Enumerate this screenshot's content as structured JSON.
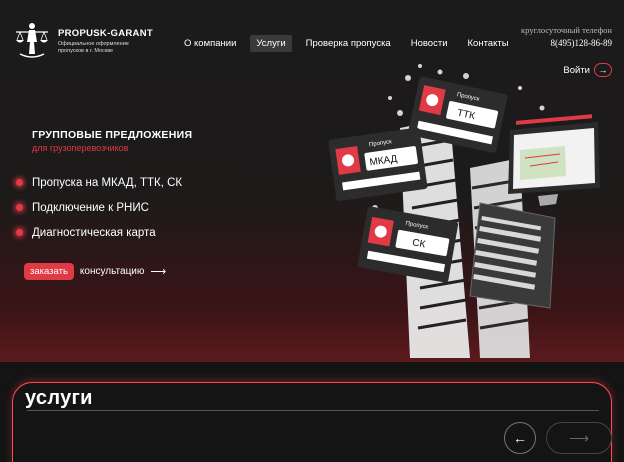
{
  "logo": {
    "title": "PROPUSK-GARANT",
    "subtitle": "Официальное оформление пропусков в г. Москве"
  },
  "nav": {
    "items": [
      {
        "label": "О компании",
        "active": false
      },
      {
        "label": "Услуги",
        "active": true
      },
      {
        "label": "Проверка пропуска",
        "active": false
      },
      {
        "label": "Новости",
        "active": false
      },
      {
        "label": "Контакты",
        "active": false
      }
    ]
  },
  "contact": {
    "phone_label": "круглосуточный телефон",
    "phone": "8(495)128-86-89"
  },
  "login": {
    "label": "Войти"
  },
  "hero": {
    "title": "ГРУППОВЫЕ ПРЕДЛОЖЕНИЯ",
    "subtitle": "для грузоперевозчиков",
    "features": [
      "Пропуска на МКАД, ТТК, СК",
      "Подключение к РНИС",
      "Диагностическая карта"
    ],
    "cta_button": "заказать",
    "cta_text": "консультацию",
    "cta_arrow": "⟶"
  },
  "illustration": {
    "pass_header": "Пропуск",
    "passes": [
      "ТТК",
      "МКАД",
      "СК"
    ]
  },
  "services": {
    "title": "услуги",
    "prev_arrow": "←",
    "next_arrow": "⟶"
  },
  "colors": {
    "accent": "#e03a44",
    "background": "#141414"
  }
}
